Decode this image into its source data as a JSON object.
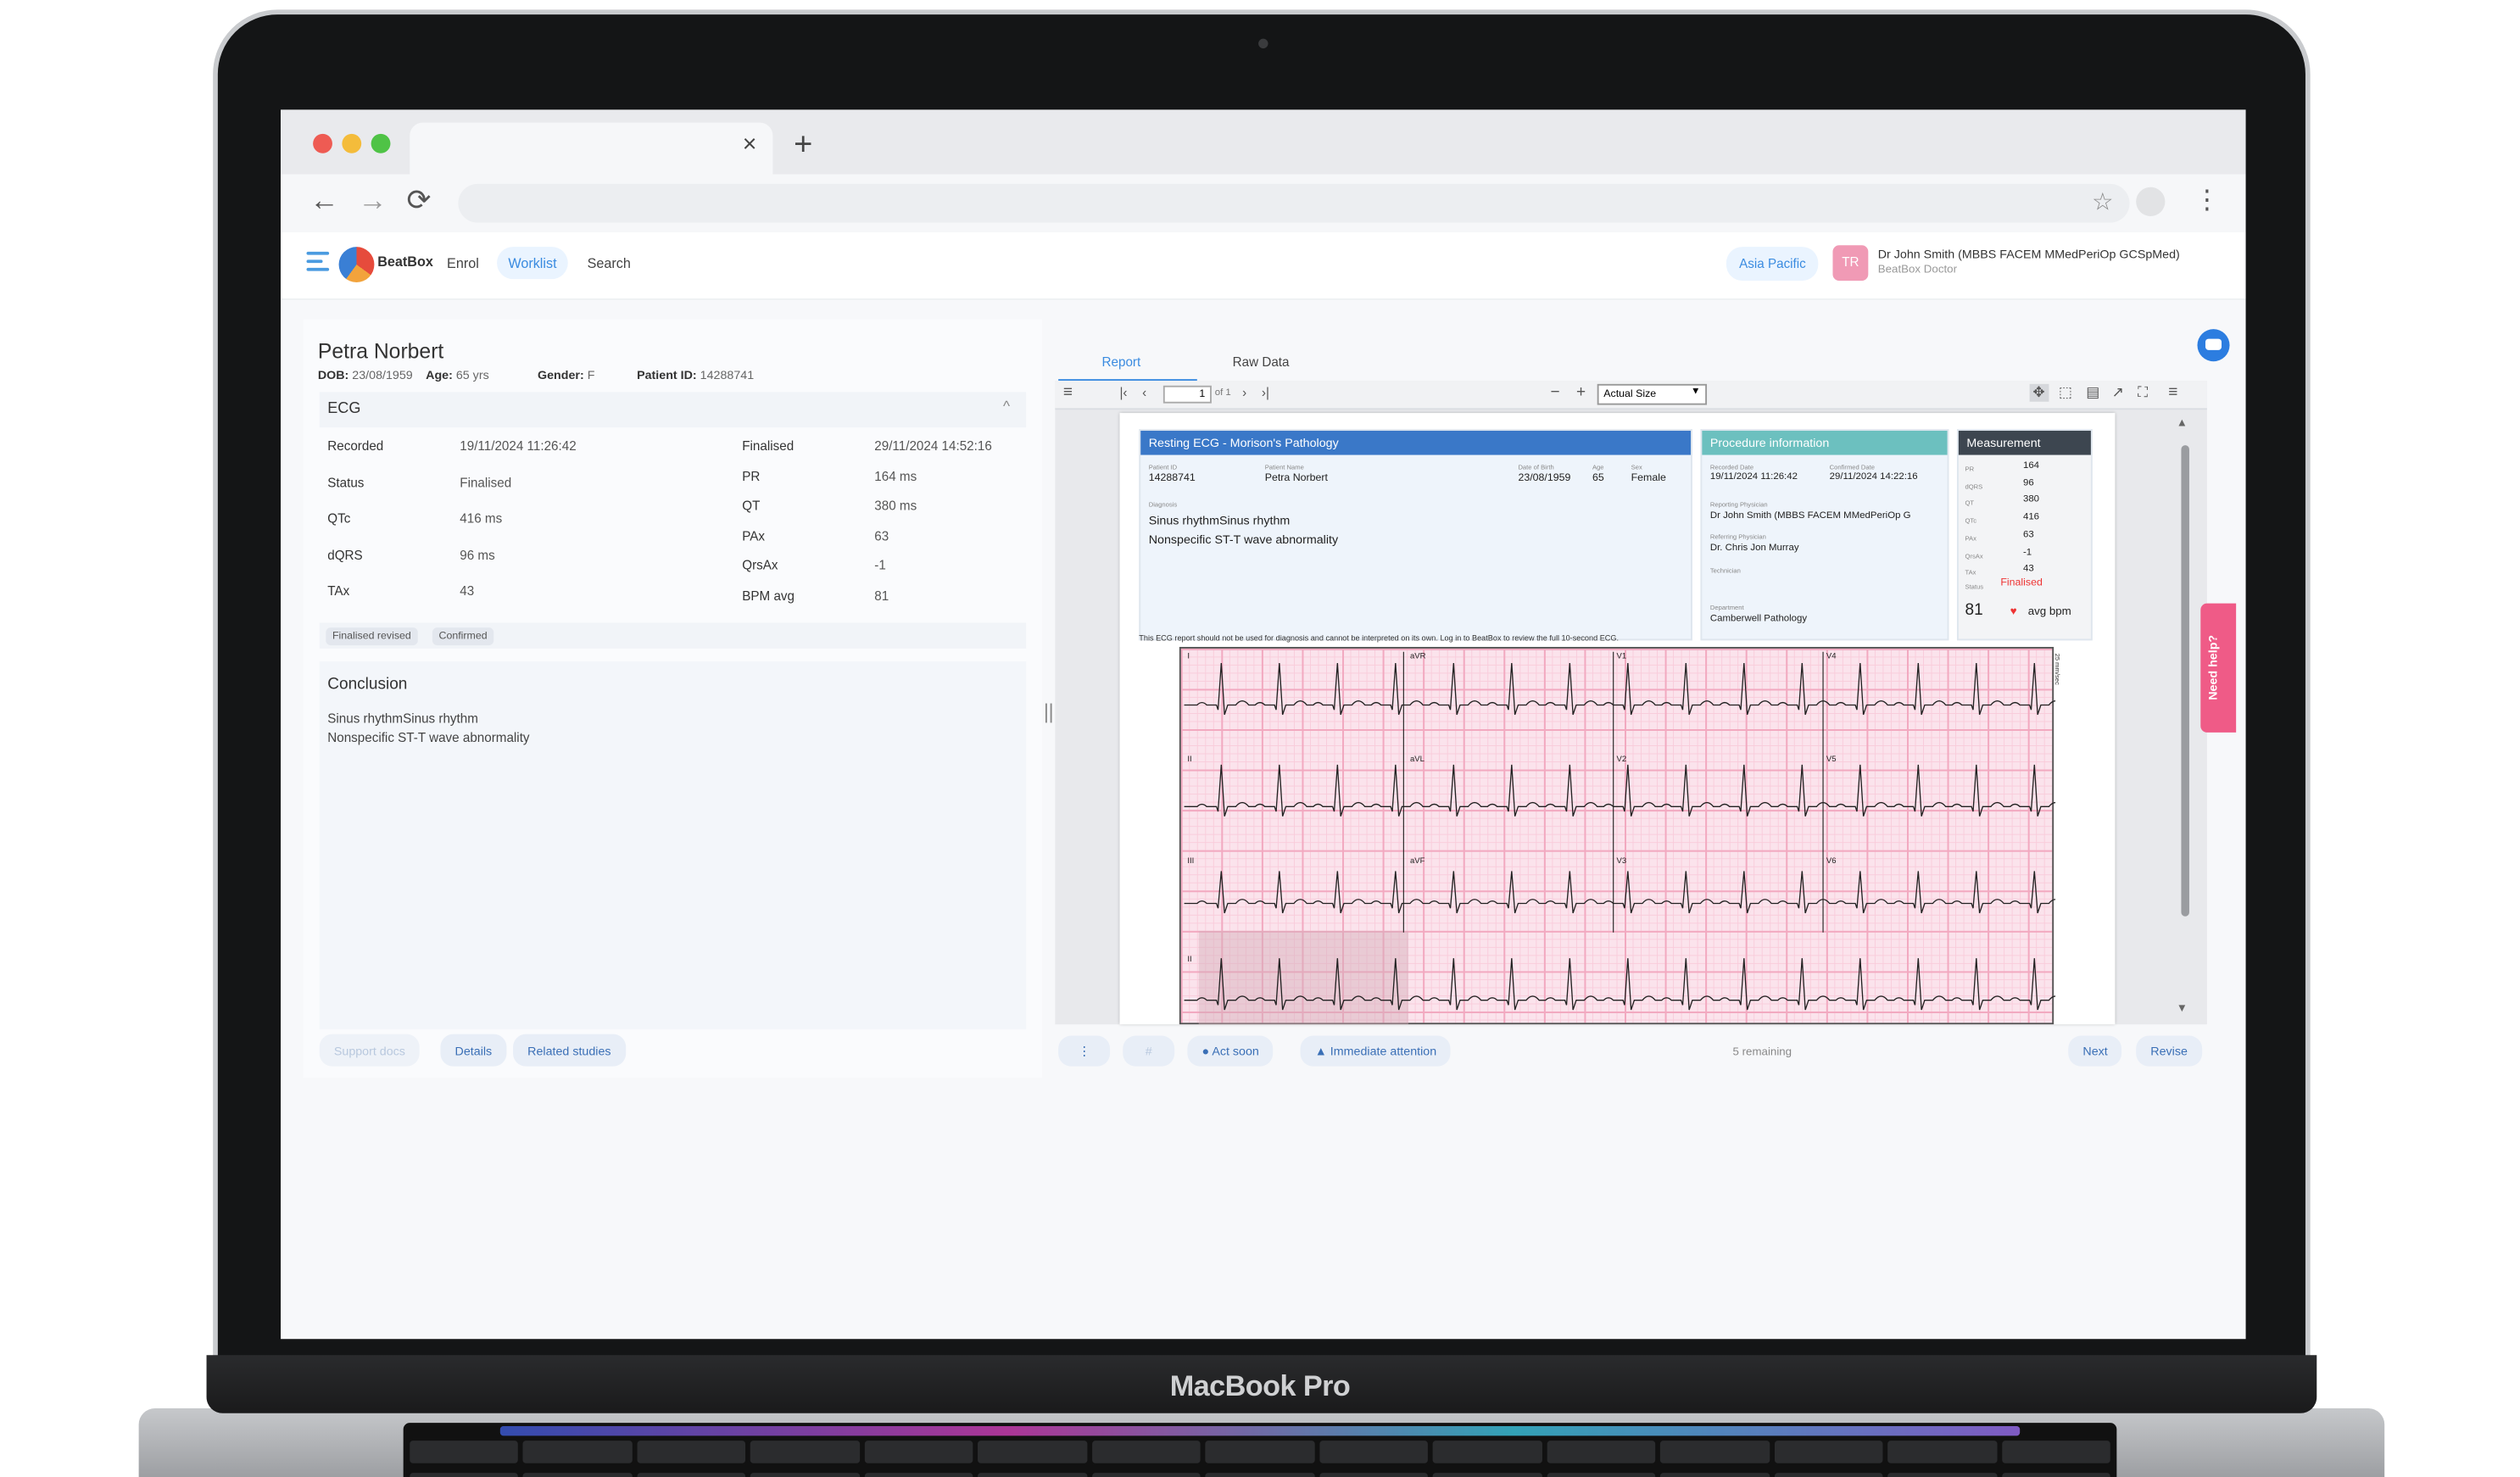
{
  "device": {
    "brand_label": "MacBook Pro"
  },
  "browser": {
    "tab_close": "×",
    "new_tab": "+",
    "back": "←",
    "forward": "→",
    "reload": "⟳",
    "star": "☆",
    "menu": "⋮"
  },
  "app": {
    "logo_text": "BeatBox",
    "nav": [
      {
        "label": "Enrol"
      },
      {
        "label": "Worklist"
      },
      {
        "label": "Search"
      }
    ],
    "region": "Asia Pacific",
    "user": {
      "initials": "TR",
      "name": "Dr John Smith (MBBS FACEM MMedPeriOp GCSpMed)",
      "role": "BeatBox Doctor"
    }
  },
  "patient": {
    "name": "Petra Norbert",
    "dob_label": "DOB:",
    "dob": "23/08/1959",
    "age_label": "Age:",
    "age": "65 yrs",
    "gender_label": "Gender:",
    "gender": "F",
    "id_label": "Patient ID:",
    "id": "14288741"
  },
  "ecg": {
    "section_title": "ECG",
    "collapse_icon": "^",
    "left_fields": [
      {
        "label": "Recorded",
        "value": "19/11/2024 11:26:42"
      },
      {
        "label": "Status",
        "value": "Finalised"
      },
      {
        "label": "QTc",
        "value": "416 ms"
      },
      {
        "label": "dQRS",
        "value": "96 ms"
      },
      {
        "label": "TAx",
        "value": "43"
      }
    ],
    "right_fields": [
      {
        "label": "Finalised",
        "value": "29/11/2024 14:52:16"
      },
      {
        "label": "PR",
        "value": "164 ms"
      },
      {
        "label": "QT",
        "value": "380 ms"
      },
      {
        "label": "PAx",
        "value": "63"
      },
      {
        "label": "QrsAx",
        "value": "-1"
      },
      {
        "label": "BPM avg",
        "value": "81"
      }
    ],
    "flags": [
      "Finalised revised",
      "Confirmed"
    ]
  },
  "conclusion": {
    "title": "Conclusion",
    "lines": [
      "Sinus rhythmSinus rhythm",
      "Nonspecific ST-T wave abnormality"
    ]
  },
  "left_buttons": [
    {
      "label": "Support docs"
    },
    {
      "label": "Details"
    },
    {
      "label": "Related studies"
    }
  ],
  "viewer_tabs": [
    {
      "label": "Report"
    },
    {
      "label": "Raw Data"
    }
  ],
  "viewer_toolbar": {
    "page": "1",
    "of": "of 1",
    "zoom": "Actual Size"
  },
  "report": {
    "header_title": "Resting ECG -  Morison's Pathology",
    "proc_title": "Procedure information",
    "meas_title": "Measurement",
    "labels": {
      "patient_id": "Patient ID",
      "patient_name": "Patient Name",
      "dob": "Date of Birth",
      "age": "Age",
      "sex": "Sex",
      "diagnosis": "Diagnosis",
      "recorded_date": "Recorded Date",
      "confirmed_date": "Confirmed Date",
      "reporting": "Reporting Physician",
      "referring": "Referring Physician",
      "technician": "Technician",
      "department": "Department",
      "status": "Status"
    },
    "patient_id": "14288741",
    "patient_name": "Petra  Norbert",
    "dob": "23/08/1959",
    "age": "65",
    "sex": "Female",
    "diagnosis": [
      "Sinus rhythmSinus rhythm",
      "Nonspecific ST-T wave abnormality"
    ],
    "recorded_date": "19/11/2024 11:26:42",
    "confirmed_date": "29/11/2024 14:22:16",
    "reporting": "Dr John Smith (MBBS FACEM MMedPeriOp G",
    "referring": "Dr. Chris Jon Murray",
    "department": "Camberwell Pathology",
    "measurements": [
      {
        "label": "PR",
        "value": "164"
      },
      {
        "label": "dQRS",
        "value": "96"
      },
      {
        "label": "QT",
        "value": "380"
      },
      {
        "label": "QTc",
        "value": "416"
      },
      {
        "label": "PAx",
        "value": "63"
      },
      {
        "label": "QrsAx",
        "value": "-1"
      },
      {
        "label": "TAx",
        "value": "43"
      }
    ],
    "status": "Finalised",
    "bpm": "81",
    "bpm_unit": "avg bpm",
    "disclaimer": "This ECG report should not be used for diagnosis and cannot be interpreted on its own. Log in to BeatBox to review the full 10-second ECG.",
    "speed": "25 mm/sec",
    "leads": [
      "I",
      "aVR",
      "V1",
      "V4",
      "II",
      "aVL",
      "V2",
      "V5",
      "III",
      "aVF",
      "V3",
      "V6",
      "II"
    ]
  },
  "actions": {
    "more": "⋮",
    "flag": "#",
    "act_soon": "Act soon",
    "immediate": "Immediate attention",
    "remaining": "5 remaining",
    "next": "Next",
    "revise": "Revise"
  },
  "help": {
    "label": "Need help?"
  },
  "colors": {
    "accent": "#3a8be0",
    "report_header": "#3a78c8",
    "proc_header": "#6cc0bf",
    "meas_header": "#3d4650",
    "help": "#ef5b87",
    "ecg_grid": "#fbe3ec"
  }
}
